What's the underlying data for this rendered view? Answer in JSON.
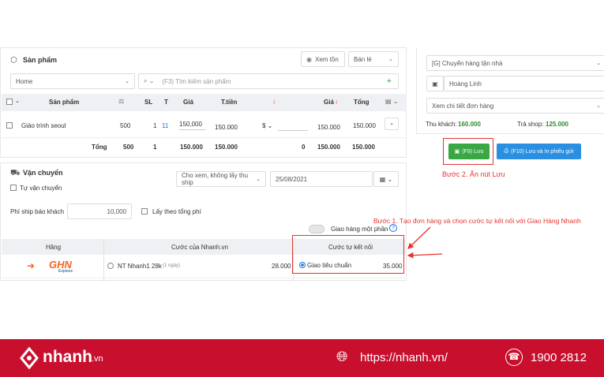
{
  "products": {
    "title": "Sản phẩm",
    "view_stock": "Xem tồn",
    "sale_type": "Bán lẻ",
    "warehouse": "Home",
    "search_placeholder": "(F3) Tìm kiếm sản phẩm",
    "headers": {
      "product": "Sản phẩm",
      "qty": "SL",
      "t": "T",
      "price": "Giá",
      "total": "T.tiền",
      "price2": "Giá",
      "sum": "Tổng"
    },
    "row": {
      "name": "Giáo trình seoul",
      "qty_stock": "500",
      "qty": "1",
      "t": "11",
      "price": "150,000",
      "total": "150.000",
      "currency": "$",
      "price2": "150.000",
      "sum": "150.000"
    },
    "totals": {
      "label": "Tổng",
      "stock": "500",
      "qty": "1",
      "price": "150.000",
      "total": "150.000",
      "discount": "0",
      "price2": "150.000",
      "sum": "150.000"
    }
  },
  "shipping": {
    "title": "Vận chuyển",
    "self_ship": "Tự vận chuyển",
    "view_mode": "Cho xem, không lấy thu ship",
    "date": "25/08/2021",
    "fee_label": "Phí ship báo khách",
    "fee_value": "10,000",
    "take_total": "Lấy theo tổng phí",
    "one_part": "Giao hàng một phần",
    "table_headers": {
      "carrier": "Hãng",
      "nhanh_rate": "Cước của Nhanh.vn",
      "connected_rate": "Cước tự kết nối"
    },
    "ghn": {
      "logo": "GHN",
      "logo_sub": "Express",
      "service": "NT Nhanh1 28k",
      "days": "(1 ngày)",
      "price": "28.000",
      "connected_service": "Giao tiêu chuẩn",
      "connected_price": "35.000"
    }
  },
  "right": {
    "delivery_type": "[G] Chuyển hàng tận nhà",
    "customer": "Hoàng Linh",
    "order_detail": "Xem chi tiết đơn hàng",
    "collect_label": "Thu khách:",
    "collect_value": "160.000",
    "pay_shop_label": "Trả shop:",
    "pay_shop_value": "125.000",
    "save_btn": "(F9) Lưu",
    "save_print_btn": "(F10) Lưu và In phiếu gửi"
  },
  "annotations": {
    "step2": "Bước 2. Ấn nút Lưu",
    "step1": "Bước 1. Tạo đơn hàng và chọn cước tự kết nối với Giao Hàng Nhanh"
  },
  "footer": {
    "brand": "nhanh",
    "brand_suffix": ".vn",
    "url": "https://nhanh.vn/",
    "phone": "1900 2812"
  },
  "colors": {
    "brand_red": "#c8102e",
    "save_green": "#3aa745",
    "print_blue": "#2a8fe0",
    "annotation_red": "#e3342f"
  }
}
